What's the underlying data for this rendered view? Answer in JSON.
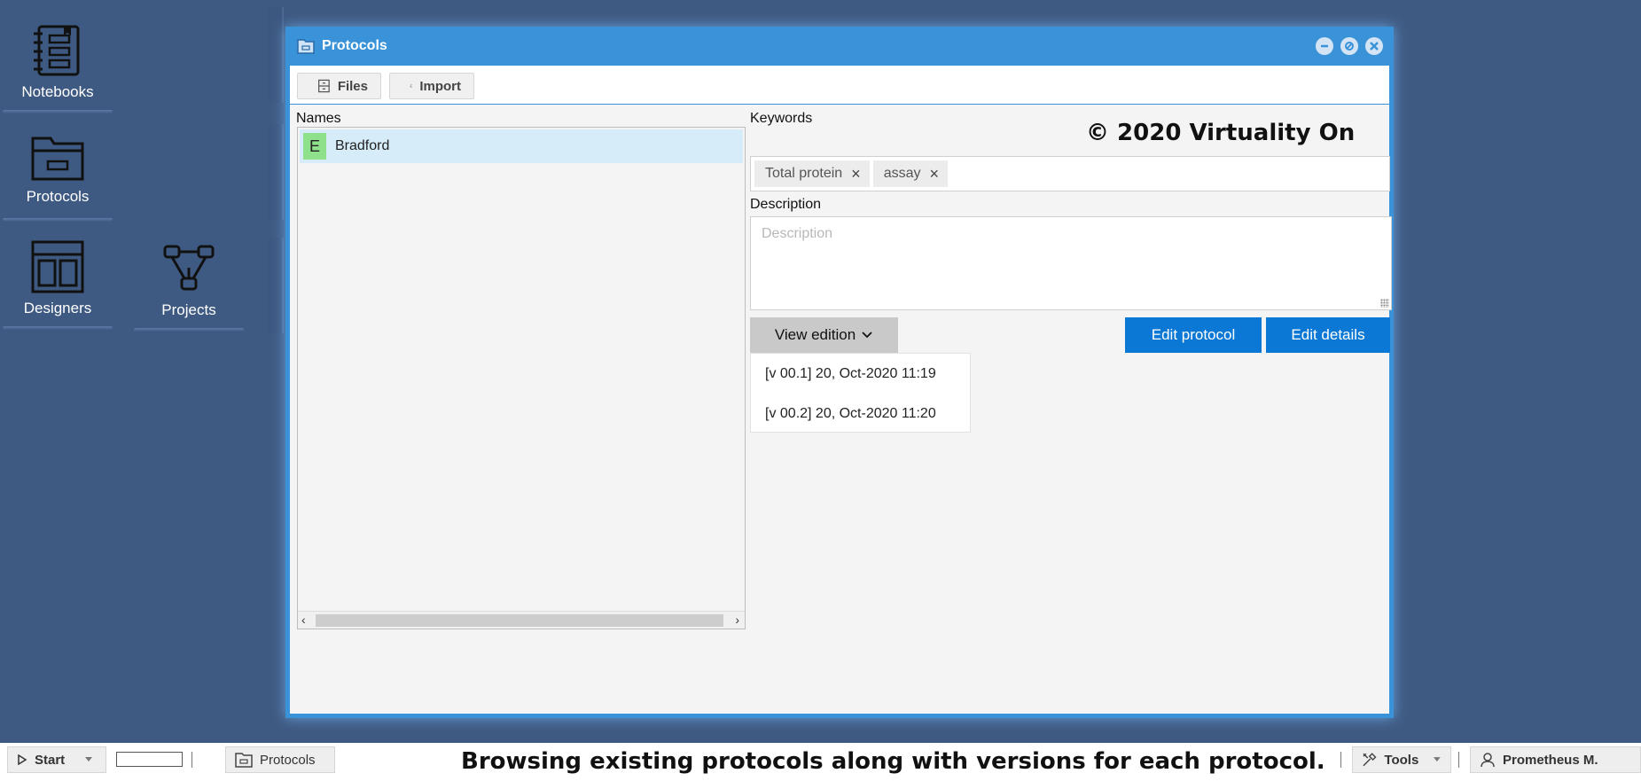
{
  "desktop": {
    "icons": [
      {
        "label": "Notebooks"
      },
      {
        "label": "Protocols"
      },
      {
        "label": "Designers"
      },
      {
        "label": "Projects"
      }
    ]
  },
  "window": {
    "title": "Protocols",
    "toolbar": {
      "files_label": "Files",
      "import_label": "Import"
    },
    "names_header": "Names",
    "names": [
      {
        "badge": "E",
        "name": "Bradford"
      }
    ],
    "keywords_header": "Keywords",
    "keywords": [
      "Total protein",
      "assay"
    ],
    "description_header": "Description",
    "description_placeholder": "Description",
    "view_edition_label": "View edition",
    "editions": [
      "[v 00.1] 20, Oct-2020 11:19",
      "[v 00.2] 20, Oct-2020 11:20"
    ],
    "edit_protocol_label": "Edit protocol",
    "edit_details_label": "Edit details",
    "copyright": "© 2020 Virtuality On"
  },
  "taskbar": {
    "start_label": "Start",
    "active_app": "Protocols",
    "caption": "Browsing existing protocols along with versions for each protocol.",
    "tools_label": "Tools",
    "user_label": "Prometheus M."
  },
  "colors": {
    "desktop_bg": "#3f5a82",
    "accent": "#3a93d8",
    "primary_button": "#0a78d4",
    "selected_row": "#d6ecf8",
    "badge": "#8fe08a"
  }
}
